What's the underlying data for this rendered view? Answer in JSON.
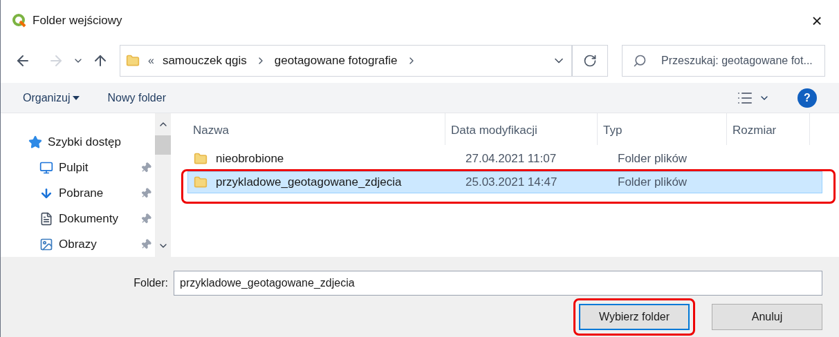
{
  "window": {
    "title": "Folder wejściowy",
    "close": "×"
  },
  "address": {
    "overflow": "«",
    "crumbs": [
      "samouczek qgis",
      "geotagowane fotografie"
    ]
  },
  "search": {
    "placeholder": "Przeszukaj: geotagowane fot..."
  },
  "toolbar": {
    "organize": "Organizuj",
    "new_folder": "Nowy folder",
    "help": "?"
  },
  "sidebar": {
    "items": [
      {
        "label": "Szybki dostęp",
        "kind": "star",
        "pinned": false
      },
      {
        "label": "Pulpit",
        "kind": "desktop",
        "pinned": true
      },
      {
        "label": "Pobrane",
        "kind": "download",
        "pinned": true
      },
      {
        "label": "Dokumenty",
        "kind": "document",
        "pinned": true
      },
      {
        "label": "Obrazy",
        "kind": "image",
        "pinned": true
      }
    ]
  },
  "table": {
    "columns": [
      "Nazwa",
      "Data modyfikacji",
      "Typ",
      "Rozmiar"
    ],
    "rows": [
      {
        "name": "nieobrobione",
        "modified": "27.04.2021 11:07",
        "type": "Folder plików",
        "selected": false,
        "highlighted": false
      },
      {
        "name": "przykladowe_geotagowane_zdjecia",
        "modified": "25.03.2021 14:47",
        "type": "Folder plików",
        "selected": true,
        "highlighted": true
      }
    ]
  },
  "folder_field": {
    "label": "Folder:",
    "value": "przykladowe_geotagowane_zdjecia"
  },
  "buttons": [
    {
      "label": "Wybierz folder",
      "highlighted": true
    },
    {
      "label": "Anuluj",
      "highlighted": false
    }
  ]
}
